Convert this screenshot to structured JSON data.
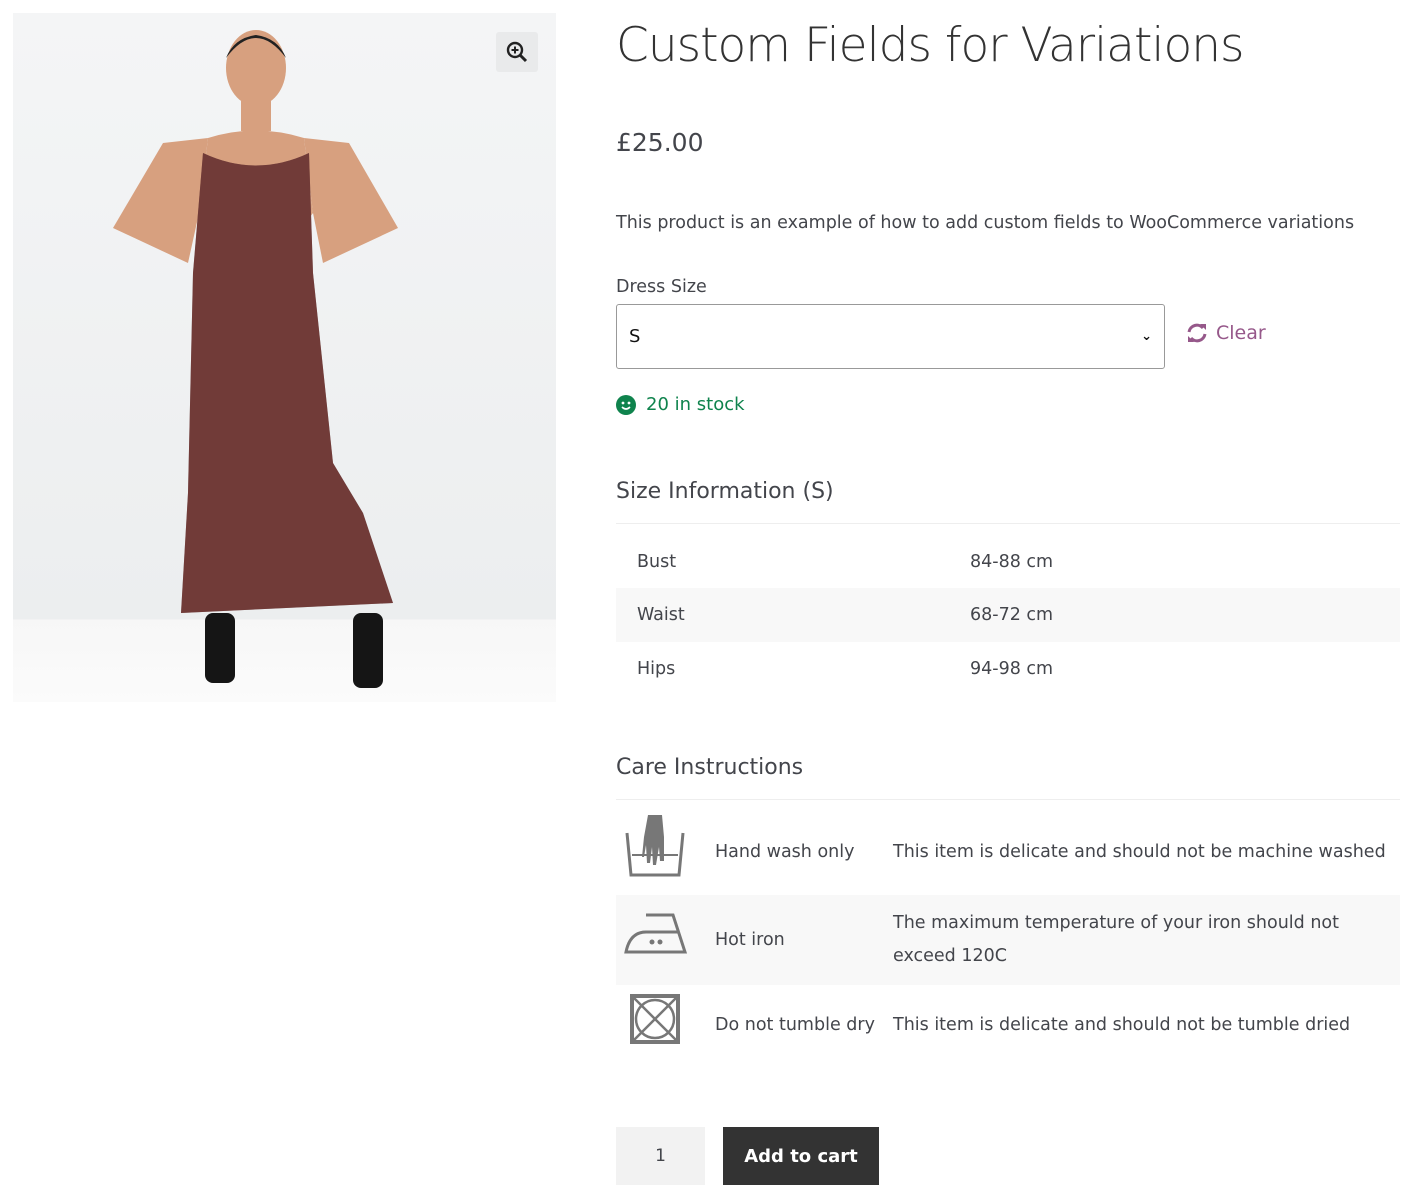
{
  "product": {
    "title": "Custom Fields for Variations",
    "price": "£25.00",
    "description": "This product is an example of how to add custom fields to WooCommerce variations"
  },
  "variation": {
    "label": "Dress Size",
    "selected": "S",
    "clear_label": "Clear",
    "stock": "20 in stock"
  },
  "size_info": {
    "heading": "Size Information (S)",
    "rows": [
      {
        "name": "Bust",
        "value": "84-88 cm"
      },
      {
        "name": "Waist",
        "value": "68-72 cm"
      },
      {
        "name": "Hips",
        "value": "94-98 cm"
      }
    ]
  },
  "care": {
    "heading": "Care Instructions",
    "rows": [
      {
        "icon": "hand-wash-icon",
        "name": "Hand wash only",
        "text": "This item is delicate and should not be machine washed"
      },
      {
        "icon": "iron-icon",
        "name": "Hot iron",
        "text": "The maximum temperature of your iron should not exceed 120C"
      },
      {
        "icon": "no-tumble-dry-icon",
        "name": "Do not tumble dry",
        "text": "This item is delicate and should not be tumble dried"
      }
    ]
  },
  "cart": {
    "quantity": "1",
    "add_label": "Add to cart"
  },
  "colors": {
    "accent": "#96588a",
    "stock": "#0f834d",
    "button": "#333333"
  }
}
